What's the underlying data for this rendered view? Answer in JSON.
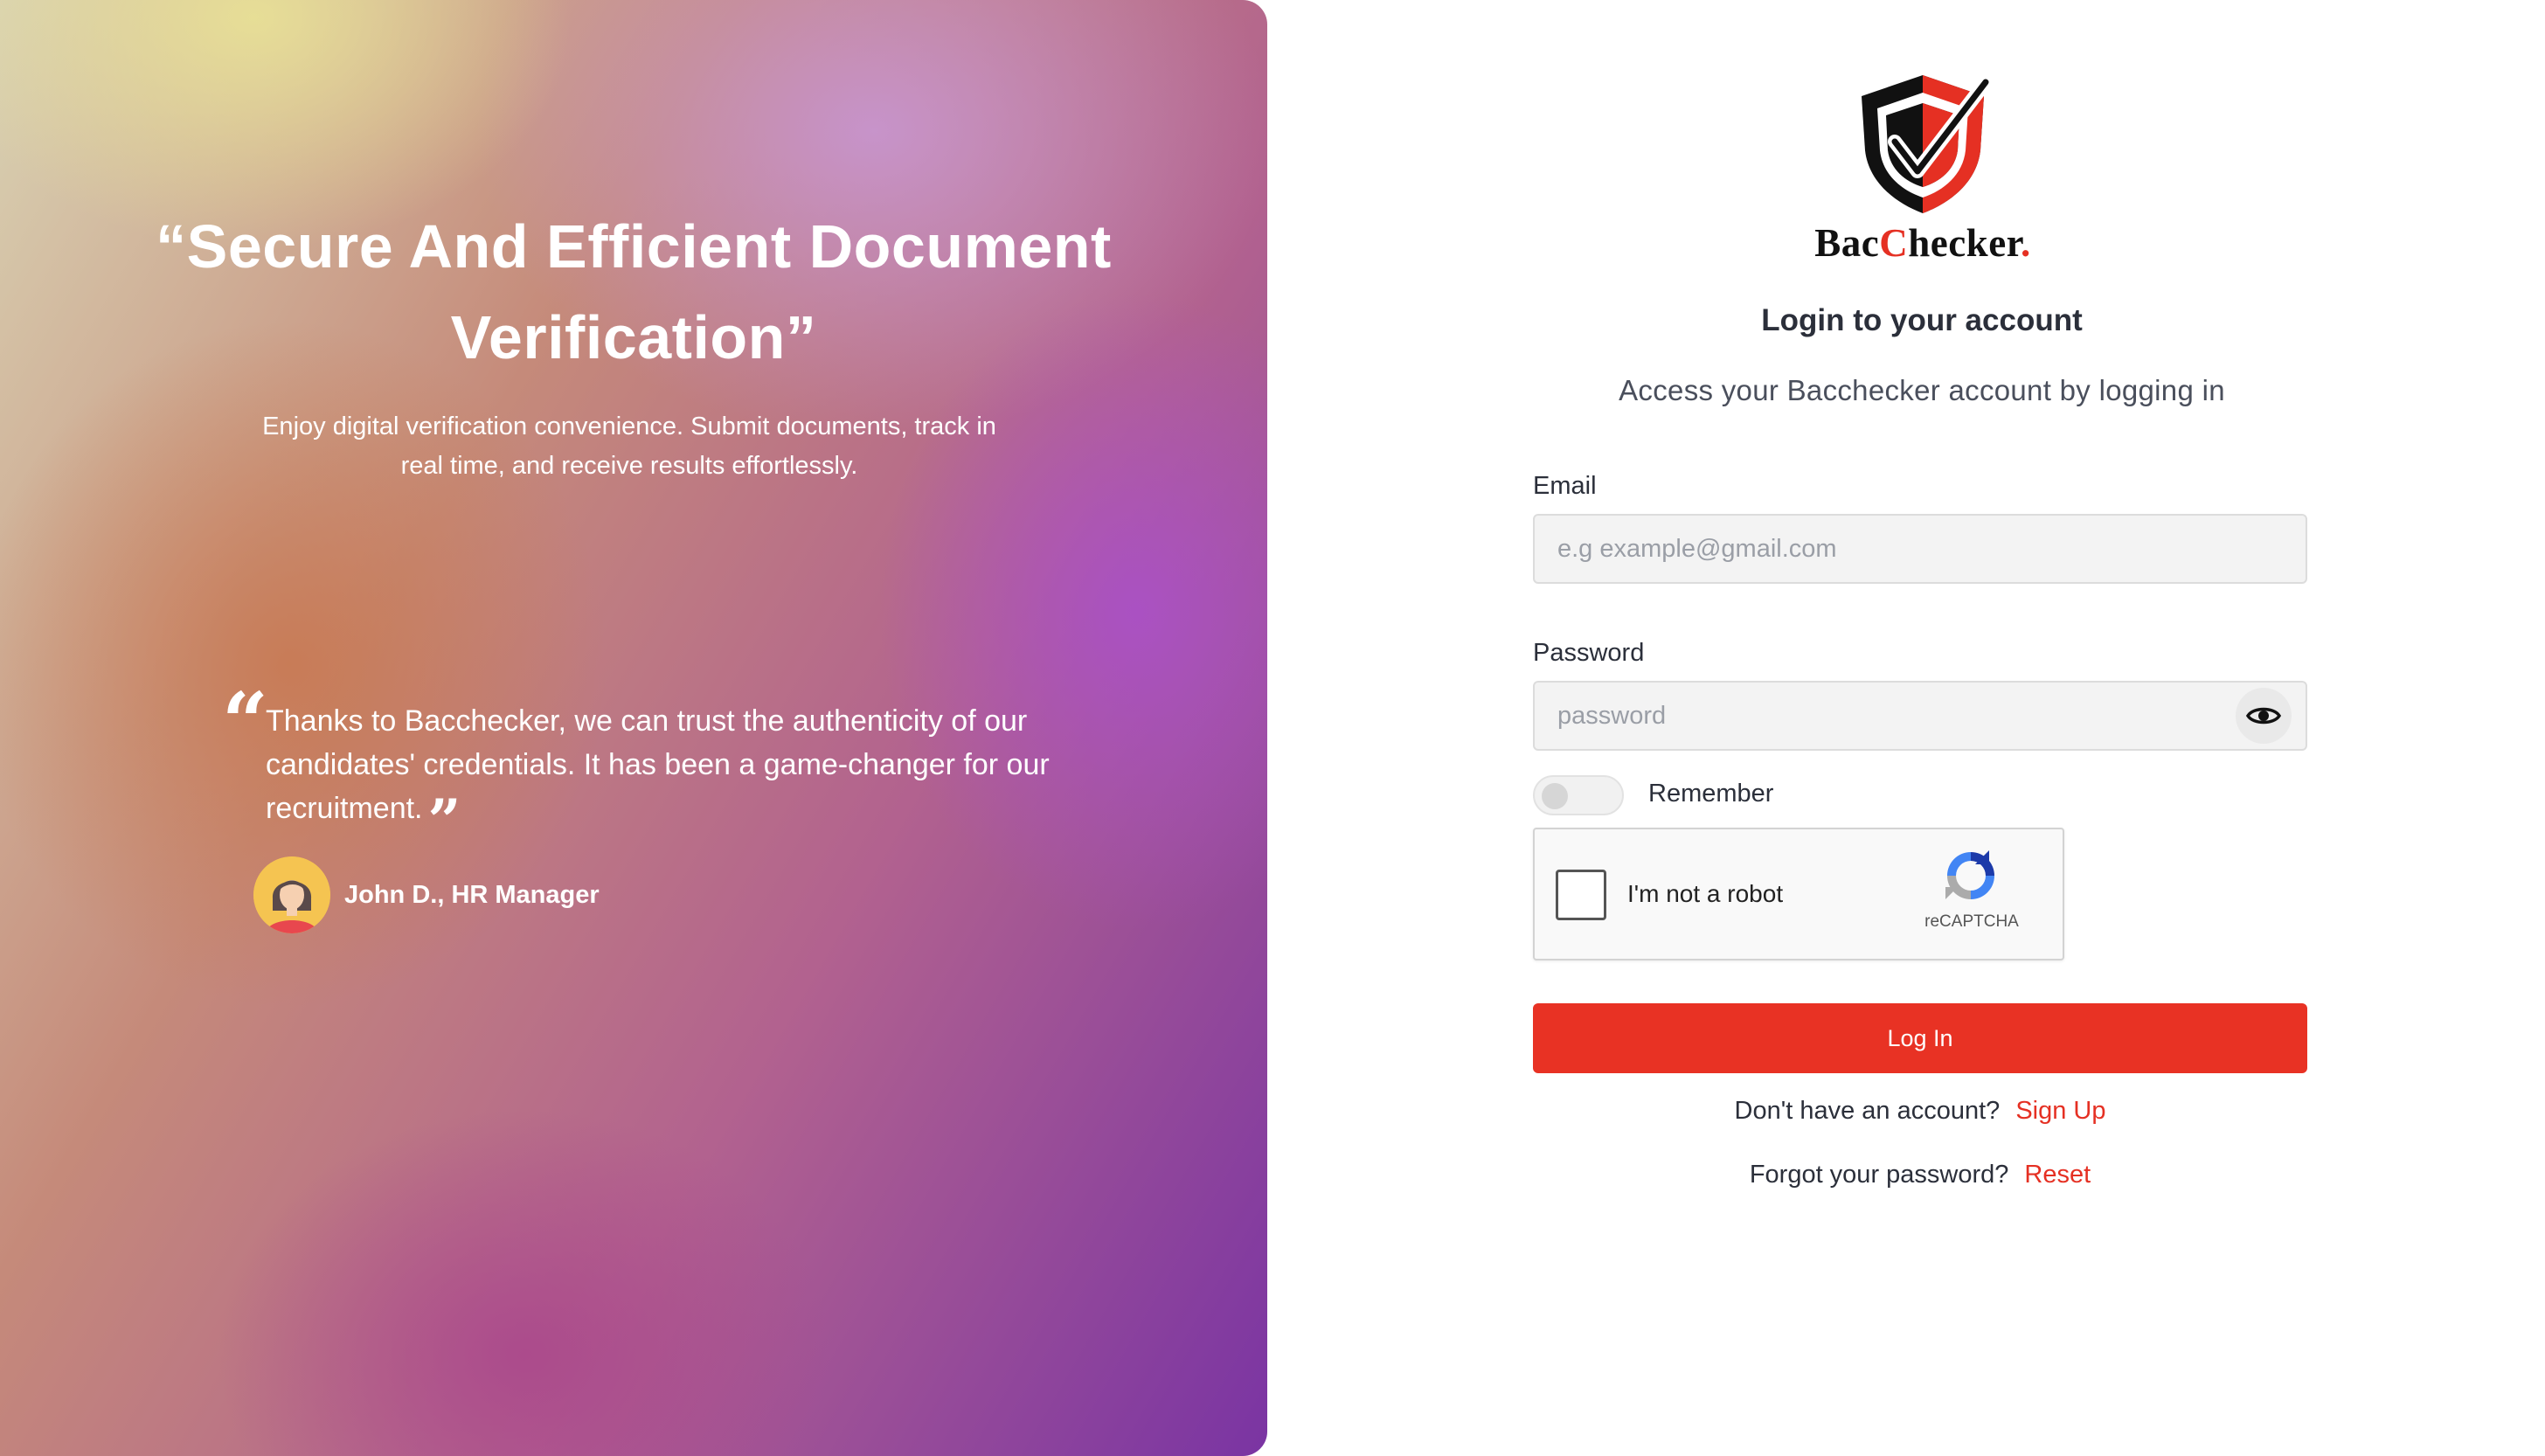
{
  "hero": {
    "title": "“Secure And Efficient Document Verification”",
    "subtitle": "Enjoy digital verification convenience. Submit documents, track in real time, and receive results effortlessly.",
    "testimonial": {
      "quote": "Thanks to Bacchecker, we can trust the authenticity of our candidates' credentials. It has been a game-changer for our recruitment.",
      "author": "John D., HR Manager"
    }
  },
  "brand": {
    "part1": "Bac",
    "part2": "C",
    "part3": "hecker",
    "dot": ".",
    "accent_color": "#e53023"
  },
  "login": {
    "title": "Login to your account",
    "subtitle": "Access your Bacchecker account by logging in",
    "email_label": "Email",
    "email_placeholder": "e.g example@gmail.com",
    "password_label": "Password",
    "password_placeholder": "password",
    "remember_label": "Remember",
    "remember_checked": false,
    "recaptcha_label": "I'm not a robot",
    "recaptcha_brand": "reCAPTCHA",
    "submit_label": "Log In",
    "signup_prompt": "Don't have an account?",
    "signup_link": "Sign Up",
    "forgot_prompt": "Forgot your password?",
    "reset_link": "Reset"
  },
  "icons": {
    "eye": "eye-icon",
    "shield": "shield-check-logo",
    "quote": "quote-icon",
    "recaptcha": "recaptcha-icon",
    "avatar": "avatar"
  }
}
